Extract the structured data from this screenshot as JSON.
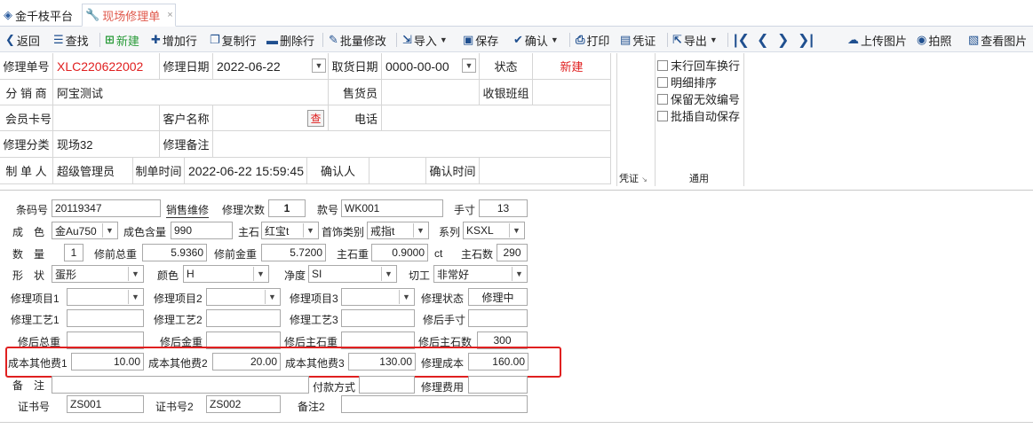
{
  "tabs": [
    {
      "label": "金千枝平台",
      "icon": "diamond-icon"
    },
    {
      "label": "现场修理单",
      "icon": "wrench-icon",
      "close": "×"
    }
  ],
  "toolbar": {
    "back": "返回",
    "find": "查找",
    "new": "新建",
    "add_row": "增加行",
    "copy_row": "复制行",
    "delete_row": "删除行",
    "batch_edit": "批量修改",
    "import": "导入",
    "save": "保存",
    "confirm": "确认",
    "print": "打印",
    "voucher": "凭证",
    "export": "导出",
    "upload_image": "上传图片",
    "photo": "拍照",
    "view_image": "查看图片"
  },
  "header": {
    "order_no_label": "修理单号",
    "order_no": "XLC220622002",
    "repair_date_label": "修理日期",
    "repair_date": "2022-06-22",
    "pickup_date_label": "取货日期",
    "pickup_date": "0000-00-00",
    "status_label": "状态",
    "status": "新建",
    "distributor_label": "分 销 商",
    "distributor": "阿宝测试",
    "salesperson_label": "售货员",
    "cashier_group_label": "收银班组",
    "member_card_label": "会员卡号",
    "customer_name_label": "客户名称",
    "query": "查",
    "phone_label": "电话",
    "category_label": "修理分类",
    "category": "现场32",
    "remark_label": "修理备注",
    "creator_label": "制 单 人",
    "creator": "超级管理员",
    "create_time_label": "制单时间",
    "create_time": "2022-06-22 15:59:45",
    "confirmer_label": "确认人",
    "confirm_time_label": "确认时间"
  },
  "options": {
    "items": [
      "末行回车换行",
      "明细排序",
      "保留无效编号",
      "批插自动保存"
    ],
    "voucher_group": "凭证",
    "general_group": "通用"
  },
  "detail": {
    "barcode_label": "条码号",
    "barcode": "20119347",
    "sales_repair": "销售维修",
    "repair_count_label": "修理次数",
    "repair_count": "1",
    "style_no_label": "款号",
    "style_no": "WK001",
    "ring_size_label": "手寸",
    "ring_size": "13",
    "color_label": "成　色",
    "color": "金Au750",
    "purity_label": "成色含量",
    "purity": "990",
    "main_stone_label": "主石",
    "main_stone": "红宝t",
    "jewelry_type_label": "首饰类别",
    "jewelry_type": "戒指t",
    "series_label": "系列",
    "series": "KSXL",
    "qty_label": "数　量",
    "qty": "1",
    "pre_total_weight_label": "修前总重",
    "pre_total_weight": "5.9360",
    "pre_gold_weight_label": "修前金重",
    "pre_gold_weight": "5.7200",
    "main_stone_weight_label": "主石重",
    "main_stone_weight": "0.9000",
    "ct": "ct",
    "main_stone_count_label": "主石数",
    "main_stone_count": "290",
    "shape_label": "形　状",
    "shape": "蛋形",
    "color2_label": "颜色",
    "color2": "H",
    "clarity_label": "净度",
    "clarity": "SI",
    "cut_label": "切工",
    "cut": "非常好",
    "item1_label": "修理项目1",
    "item2_label": "修理项目2",
    "item3_label": "修理项目3",
    "repair_status_label": "修理状态",
    "repair_status": "修理中",
    "craft1_label": "修理工艺1",
    "craft2_label": "修理工艺2",
    "craft3_label": "修理工艺3",
    "post_ring_size_label": "修后手寸",
    "post_total_weight_label": "修后总重",
    "post_gold_weight_label": "修后金重",
    "post_stone_weight_label": "修后主石重",
    "post_stone_count_label": "修后主石数",
    "post_stone_count": "300",
    "other_cost1_label": "成本其他费1",
    "other_cost1": "10.00",
    "other_cost2_label": "成本其他费2",
    "other_cost2": "20.00",
    "other_cost3_label": "成本其他费3",
    "other_cost3": "130.00",
    "repair_cost_label": "修理成本",
    "repair_cost": "160.00",
    "note_label": "备　注",
    "payment_label": "付款方式",
    "repair_fee_label": "修理费用",
    "cert_no_label": "证书号",
    "cert_no": "ZS001",
    "cert_no2_label": "证书号2",
    "cert_no2": "ZS002",
    "note2_label": "备注2"
  }
}
